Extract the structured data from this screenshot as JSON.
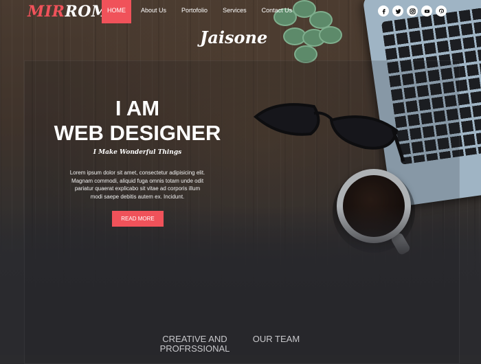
{
  "nav": {
    "logo": {
      "part1": "MIR",
      "part2": "ROM"
    },
    "items": [
      {
        "label": "HOME",
        "active": true
      },
      {
        "label": "About Us",
        "active": false
      },
      {
        "label": "Portofolio",
        "active": false
      },
      {
        "label": "Services",
        "active": false
      },
      {
        "label": "Contact Us",
        "active": false
      }
    ],
    "socials": [
      {
        "icon": "facebook-icon",
        "glyph": "f"
      },
      {
        "icon": "twitter-icon",
        "glyph": "t"
      },
      {
        "icon": "instagram-icon",
        "glyph": "i"
      },
      {
        "icon": "youtube-icon",
        "glyph": "You Tube"
      },
      {
        "icon": "pinterest-icon",
        "glyph": "p"
      }
    ]
  },
  "hero": {
    "brand": "Jaisone",
    "title_line1": "I AM",
    "title_line2": "WEB DESIGNER",
    "tagline": "I Make Wonderful Things",
    "body": "Lorem ipsum dolor sit amet, consectetur adipisicing elit. Magnam commodi, aliquid fuga omnis totam unde odit pariatur quaerat explicabo sit vitae ad corporis illum modi saepe debitis autem ex. Incidunt.",
    "cta_label": "READ MORE"
  },
  "sections": {
    "creative_line1": "CREATIVE AND",
    "creative_line2": "PROFRSSIONAL",
    "team": "OUR TEAM"
  },
  "colors": {
    "accent": "#f0525a",
    "background": "#2b2b2e"
  }
}
